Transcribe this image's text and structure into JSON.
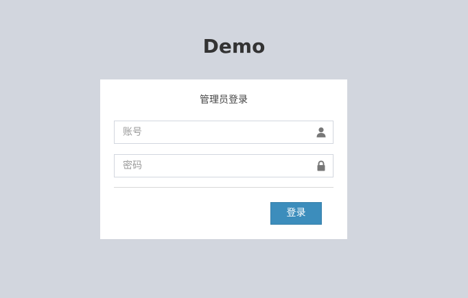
{
  "header": {
    "logo_text": "Demo"
  },
  "login": {
    "title": "管理员登录",
    "username": {
      "placeholder": "账号",
      "value": "",
      "icon": "user-icon"
    },
    "password": {
      "placeholder": "密码",
      "value": "",
      "icon": "lock-icon"
    },
    "submit_label": "登录"
  },
  "colors": {
    "background": "#d2d6de",
    "primary_button": "#3c8dbc",
    "icon": "#777777"
  }
}
